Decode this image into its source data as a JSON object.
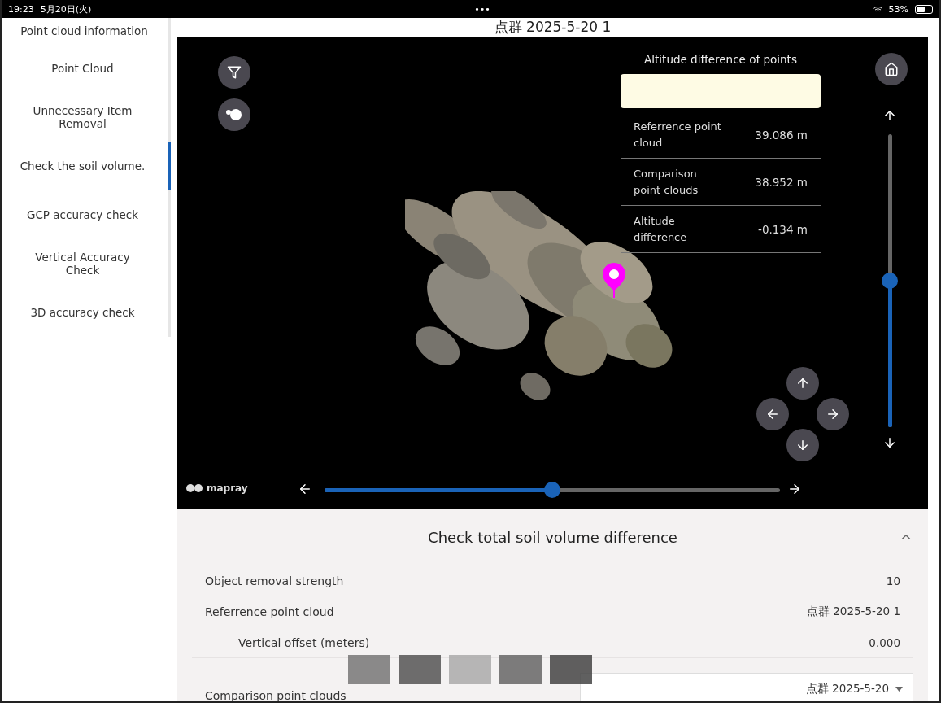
{
  "status_bar": {
    "time": "19:23",
    "date": "5月20日(火)",
    "dots": "•••",
    "battery": "53%"
  },
  "page_title": "点群 2025-5-20 1",
  "sidebar": {
    "items": [
      {
        "label": "Point cloud information",
        "selected": false
      },
      {
        "label": "Point Cloud",
        "selected": false
      },
      {
        "label": "Unnecessary Item Removal",
        "selected": false
      },
      {
        "label": "Check the soil volume.",
        "selected": true
      },
      {
        "label": "GCP accuracy check",
        "selected": false
      },
      {
        "label": "Vertical Accuracy Check",
        "selected": false
      },
      {
        "label": "3D accuracy check",
        "selected": false
      }
    ]
  },
  "viewer": {
    "logo": "mapray",
    "info_panel": {
      "title": "Altitude difference of points",
      "rows": [
        {
          "label": "Referrence point cloud",
          "value": "39.086 m"
        },
        {
          "label": "Comparison point clouds",
          "value": "38.952 m"
        },
        {
          "label": "Altitude difference",
          "value": "-0.134 m"
        }
      ]
    },
    "vertical_slider": {
      "level": 0.5
    },
    "horizontal_slider": {
      "level": 0.5
    }
  },
  "section": {
    "title": "Check total soil volume difference",
    "expanded": true,
    "rows": [
      {
        "kind": "text",
        "label": "Object removal strength",
        "value": "10",
        "indented": false
      },
      {
        "kind": "text",
        "label": "Referrence point cloud",
        "value": "点群 2025-5-20 1",
        "indented": false
      },
      {
        "kind": "text",
        "label": "Vertical offset (meters)",
        "value": "0.000",
        "indented": true
      },
      {
        "kind": "select",
        "label": "Comparison point clouds",
        "value": "点群 2025-5-20",
        "indented": false
      }
    ]
  }
}
